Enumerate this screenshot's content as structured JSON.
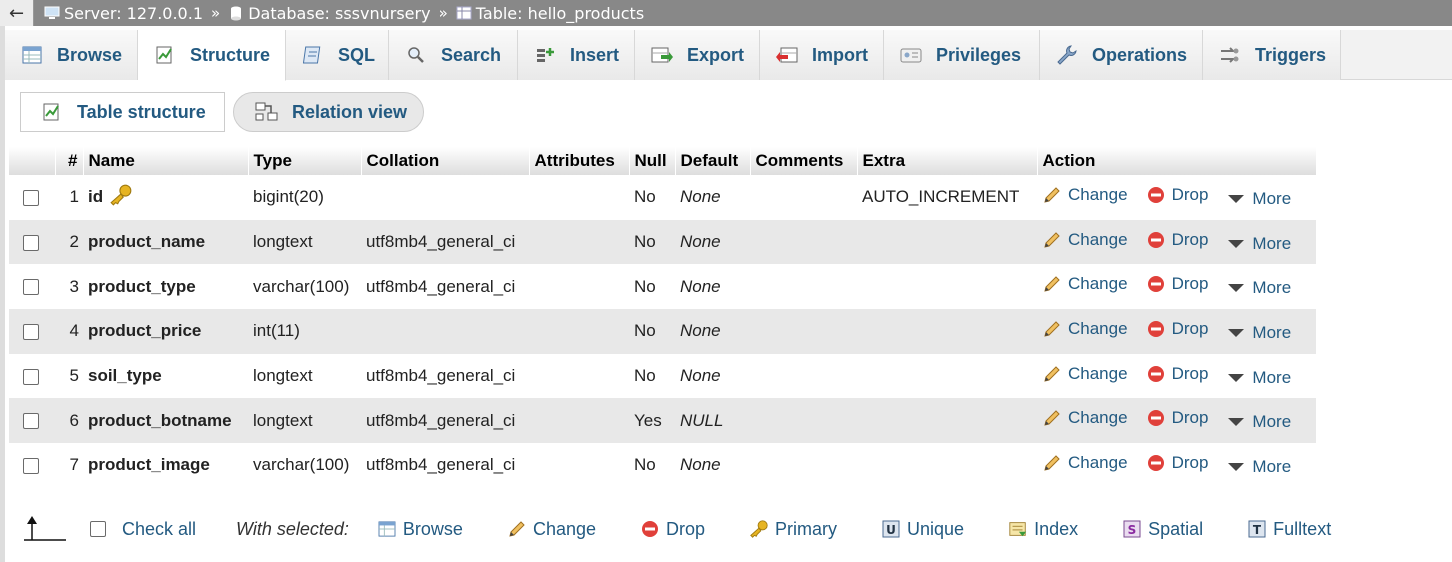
{
  "breadcrumb": {
    "back_symbol": "←",
    "server": "Server: 127.0.0.1",
    "database": "Database: sssvnursery",
    "table": "Table: hello_products",
    "separator": "»"
  },
  "tabs": [
    {
      "label": "Browse",
      "icon": "browse-icon"
    },
    {
      "label": "Structure",
      "icon": "structure-icon",
      "active": true
    },
    {
      "label": "SQL",
      "icon": "sql-icon"
    },
    {
      "label": "Search",
      "icon": "search-icon"
    },
    {
      "label": "Insert",
      "icon": "insert-icon"
    },
    {
      "label": "Export",
      "icon": "export-icon"
    },
    {
      "label": "Import",
      "icon": "import-icon"
    },
    {
      "label": "Privileges",
      "icon": "privileges-icon"
    },
    {
      "label": "Operations",
      "icon": "operations-icon"
    },
    {
      "label": "Triggers",
      "icon": "triggers-icon"
    }
  ],
  "subnav": {
    "table_structure": "Table structure",
    "relation_view": "Relation view"
  },
  "columns": {
    "num": "#",
    "name": "Name",
    "type": "Type",
    "collation": "Collation",
    "attributes": "Attributes",
    "null": "Null",
    "default": "Default",
    "comments": "Comments",
    "extra": "Extra",
    "action": "Action"
  },
  "actions": {
    "change": "Change",
    "drop": "Drop",
    "more": "More"
  },
  "rows": [
    {
      "num": "1",
      "name": "id",
      "type": "bigint(20)",
      "collation": "",
      "attributes": "",
      "null": "No",
      "default": "None",
      "comments": "",
      "extra": "AUTO_INCREMENT",
      "primary_key": true
    },
    {
      "num": "2",
      "name": "product_name",
      "type": "longtext",
      "collation": "utf8mb4_general_ci",
      "attributes": "",
      "null": "No",
      "default": "None",
      "comments": "",
      "extra": ""
    },
    {
      "num": "3",
      "name": "product_type",
      "type": "varchar(100)",
      "collation": "utf8mb4_general_ci",
      "attributes": "",
      "null": "No",
      "default": "None",
      "comments": "",
      "extra": ""
    },
    {
      "num": "4",
      "name": "product_price",
      "type": "int(11)",
      "collation": "",
      "attributes": "",
      "null": "No",
      "default": "None",
      "comments": "",
      "extra": ""
    },
    {
      "num": "5",
      "name": "soil_type",
      "type": "longtext",
      "collation": "utf8mb4_general_ci",
      "attributes": "",
      "null": "No",
      "default": "None",
      "comments": "",
      "extra": ""
    },
    {
      "num": "6",
      "name": "product_botname",
      "type": "longtext",
      "collation": "utf8mb4_general_ci",
      "attributes": "",
      "null": "Yes",
      "default": "NULL",
      "comments": "",
      "extra": ""
    },
    {
      "num": "7",
      "name": "product_image",
      "type": "varchar(100)",
      "collation": "utf8mb4_general_ci",
      "attributes": "",
      "null": "No",
      "default": "None",
      "comments": "",
      "extra": ""
    }
  ],
  "footer": {
    "check_all": "Check all",
    "with_selected": "With selected:",
    "actions": [
      {
        "label": "Browse",
        "icon": "browse-icon"
      },
      {
        "label": "Change",
        "icon": "pencil-icon"
      },
      {
        "label": "Drop",
        "icon": "drop-icon"
      },
      {
        "label": "Primary",
        "icon": "key-icon"
      },
      {
        "label": "Unique",
        "icon": "unique-icon"
      },
      {
        "label": "Index",
        "icon": "index-icon"
      },
      {
        "label": "Spatial",
        "icon": "spatial-icon"
      },
      {
        "label": "Fulltext",
        "icon": "fulltext-icon"
      }
    ]
  },
  "colors": {
    "link": "#235a81",
    "topbar": "#888888",
    "row_alt": "#e8e8e8",
    "drop_red": "#e0403a",
    "key_gold": "#e6b422"
  }
}
